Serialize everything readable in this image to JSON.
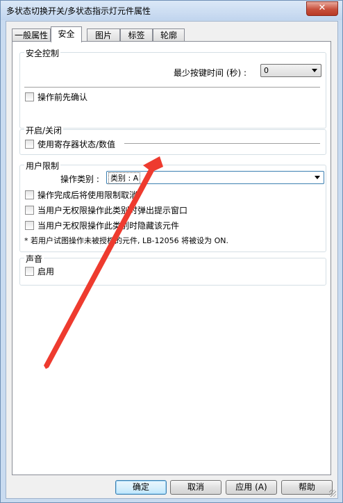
{
  "window": {
    "title": "多状态切换开关/多状态指示灯元件属性",
    "close_label": "✕"
  },
  "tabs": [
    {
      "label": "一般属性"
    },
    {
      "label": "安全"
    },
    {
      "label": "图片"
    },
    {
      "label": "标签"
    },
    {
      "label": "轮廓"
    }
  ],
  "security": {
    "legend": "安全控制",
    "min_press_label": "最少按键时间 (秒) :",
    "min_press_value": "0",
    "confirm_label": "操作前先确认"
  },
  "toggle": {
    "legend": "开启/关闭",
    "use_register_label": "使用寄存器状态/数值"
  },
  "user_restriction": {
    "legend": "用户限制",
    "category_label": "操作类别 :",
    "category_value": "类别 : A",
    "options": [
      "操作完成后将使用限制取消",
      "当用户无权限操作此类别时弹出提示窗口",
      "当用户无权限操作此类别时隐藏该元件"
    ],
    "note": "* 若用户试图操作未被授权的元件, LB-12056 将被设为 ON."
  },
  "sound": {
    "legend": "声音",
    "enable_label": "启用"
  },
  "buttons": {
    "ok": "确定",
    "cancel": "取消",
    "apply": "应用 (A)",
    "help": "帮助"
  },
  "annotation": {
    "color": "#ee3b2f"
  }
}
